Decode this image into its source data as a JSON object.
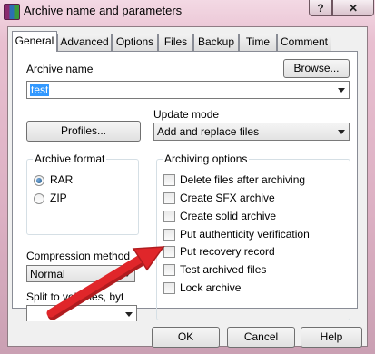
{
  "window": {
    "title": "Archive name and parameters",
    "help_glyph": "?",
    "close_glyph": "✕"
  },
  "tabs": [
    "General",
    "Advanced",
    "Options",
    "Files",
    "Backup",
    "Time",
    "Comment"
  ],
  "general": {
    "archive_name_label": "Archive name",
    "archive_name_value": "test",
    "browse_label": "Browse...",
    "profiles_label": "Profiles...",
    "update_mode_label": "Update mode",
    "update_mode_value": "Add and replace files",
    "archive_format_label": "Archive format",
    "format_options": [
      {
        "label": "RAR",
        "selected": true
      },
      {
        "label": "ZIP",
        "selected": false
      }
    ],
    "compression_label": "Compression method",
    "compression_value": "Normal",
    "split_label": "Split to volumes, bytes",
    "split_value": "",
    "archiving_options_label": "Archiving options",
    "archiving_options": [
      {
        "label": "Delete files after archiving",
        "checked": false
      },
      {
        "label": "Create SFX archive",
        "checked": false
      },
      {
        "label": "Create solid archive",
        "checked": false
      },
      {
        "label": "Put authenticity verification",
        "checked": false
      },
      {
        "label": "Put recovery record",
        "checked": false
      },
      {
        "label": "Test archived files",
        "checked": false
      },
      {
        "label": "Lock archive",
        "checked": false
      }
    ]
  },
  "buttons": {
    "ok": "OK",
    "cancel": "Cancel",
    "help": "Help"
  },
  "annotation": {
    "color": "#e0262a",
    "icon": "red-pointer-arrow"
  }
}
